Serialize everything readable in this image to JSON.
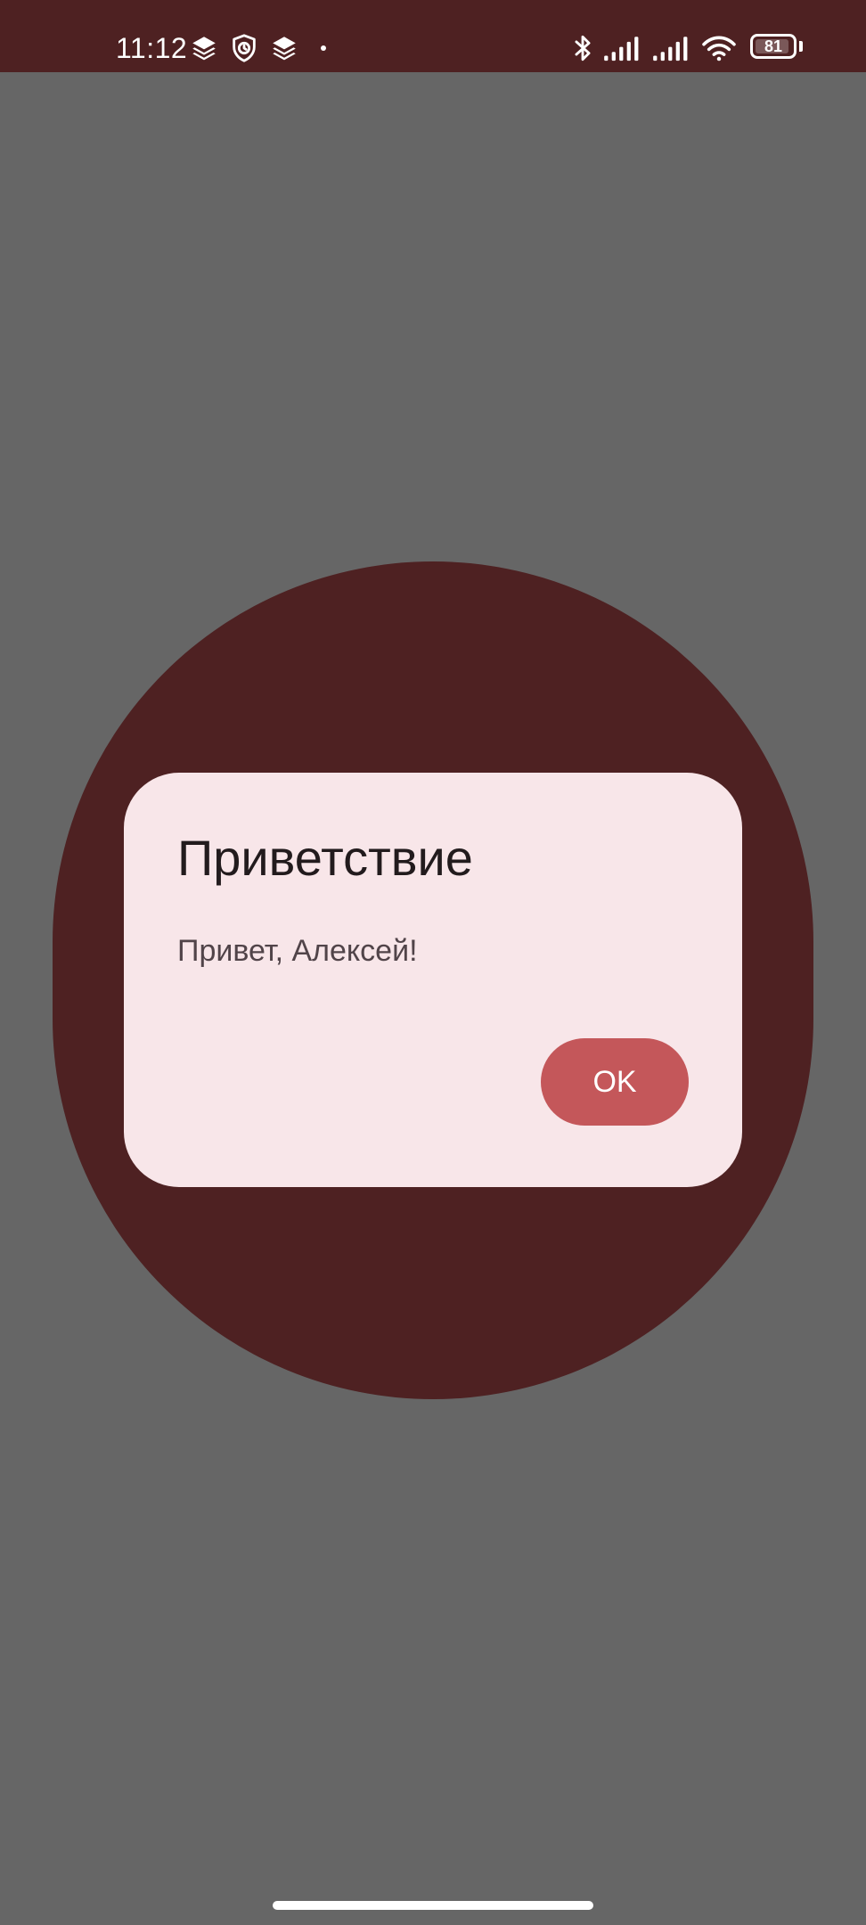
{
  "status_bar": {
    "time": "11:12",
    "battery_level": "81",
    "left_icons": [
      "layers-icon",
      "shield-clock-icon",
      "layers-icon",
      "dot-icon"
    ],
    "right_icons": [
      "bluetooth-icon",
      "signal-icon",
      "signal-icon",
      "wifi-icon",
      "battery-icon"
    ],
    "background_color": "#4e2122"
  },
  "dialog": {
    "title": "Приветствие",
    "message": "Привет, Алексей!",
    "ok_label": "OK",
    "background_color": "#f8e6e9",
    "button_color": "#c4575a"
  },
  "colors": {
    "scrim": "#666666",
    "circle": "#4e2122"
  }
}
